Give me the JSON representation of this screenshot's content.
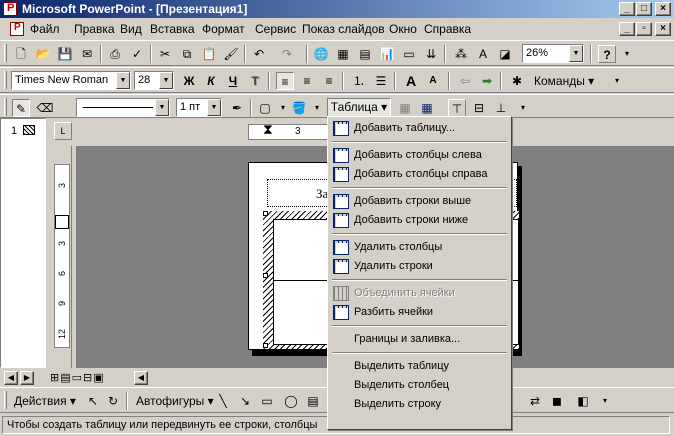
{
  "window": {
    "title": "Microsoft PowerPoint - [Презентация1]",
    "buttons": {
      "minimize": "_",
      "maximize": "□",
      "close": "×"
    }
  },
  "menubar": {
    "items": [
      "Файл",
      "Правка",
      "Вид",
      "Вставка",
      "Формат",
      "Сервис",
      "Показ слайдов",
      "Окно",
      "Справка"
    ],
    "doc_buttons": {
      "minimize": "_",
      "restore": "▫",
      "close": "×"
    }
  },
  "standard_toolbar": {
    "zoom": "26%",
    "help": "?"
  },
  "formatting_toolbar": {
    "font": "Times New Roman",
    "size": "28",
    "bold": "Ж",
    "italic": "К",
    "underline": "Ч",
    "shadow": "Т",
    "grow": "A",
    "shrink": "A",
    "commands": "Команды"
  },
  "tables_toolbar": {
    "line_weight": "1 пт",
    "table_menu": "Таблица"
  },
  "slide_pane": {
    "slide_number": "1"
  },
  "ruler": {
    "h_values": [
      "3",
      "6"
    ],
    "v_values": [
      "3",
      "3",
      "6",
      "9",
      "12"
    ]
  },
  "slide": {
    "title_fragment": "За"
  },
  "table_menu": {
    "items": [
      {
        "label": "Добавить таблицу...",
        "icon": "insert-table-icon",
        "enabled": true
      },
      {
        "sep": true
      },
      {
        "label": "Добавить столбцы слева",
        "icon": "insert-columns-left-icon",
        "enabled": true
      },
      {
        "label": "Добавить столбцы справа",
        "icon": "insert-columns-right-icon",
        "enabled": true
      },
      {
        "sep": true
      },
      {
        "label": "Добавить строки выше",
        "icon": "insert-rows-above-icon",
        "enabled": true
      },
      {
        "label": "Добавить строки ниже",
        "icon": "insert-rows-below-icon",
        "enabled": true
      },
      {
        "sep": true
      },
      {
        "label": "Удалить столбцы",
        "icon": "delete-columns-icon",
        "enabled": true
      },
      {
        "label": "Удалить строки",
        "icon": "delete-rows-icon",
        "enabled": true
      },
      {
        "sep": true
      },
      {
        "label": "Объединить ячейки",
        "icon": "merge-cells-icon",
        "enabled": false
      },
      {
        "label": "Разбить ячейки",
        "icon": "split-cells-icon",
        "enabled": true
      },
      {
        "sep": true
      },
      {
        "label": "Границы и заливка...",
        "icon": "",
        "enabled": true
      },
      {
        "sep": true
      },
      {
        "label": "Выделить таблицу",
        "icon": "",
        "enabled": true
      },
      {
        "label": "Выделить столбец",
        "icon": "",
        "enabled": true
      },
      {
        "label": "Выделить строку",
        "icon": "",
        "enabled": true
      }
    ]
  },
  "drawing_toolbar": {
    "actions": "Действия",
    "autoshapes": "Автофигуры"
  },
  "statusbar": {
    "text": "Чтобы создать таблицу или передвинуть ее строки, столбцы"
  },
  "colors": {
    "title_start": "#0a246a",
    "title_end": "#a6caf0",
    "face": "#d4d0c8",
    "menu_text": "#000000"
  }
}
